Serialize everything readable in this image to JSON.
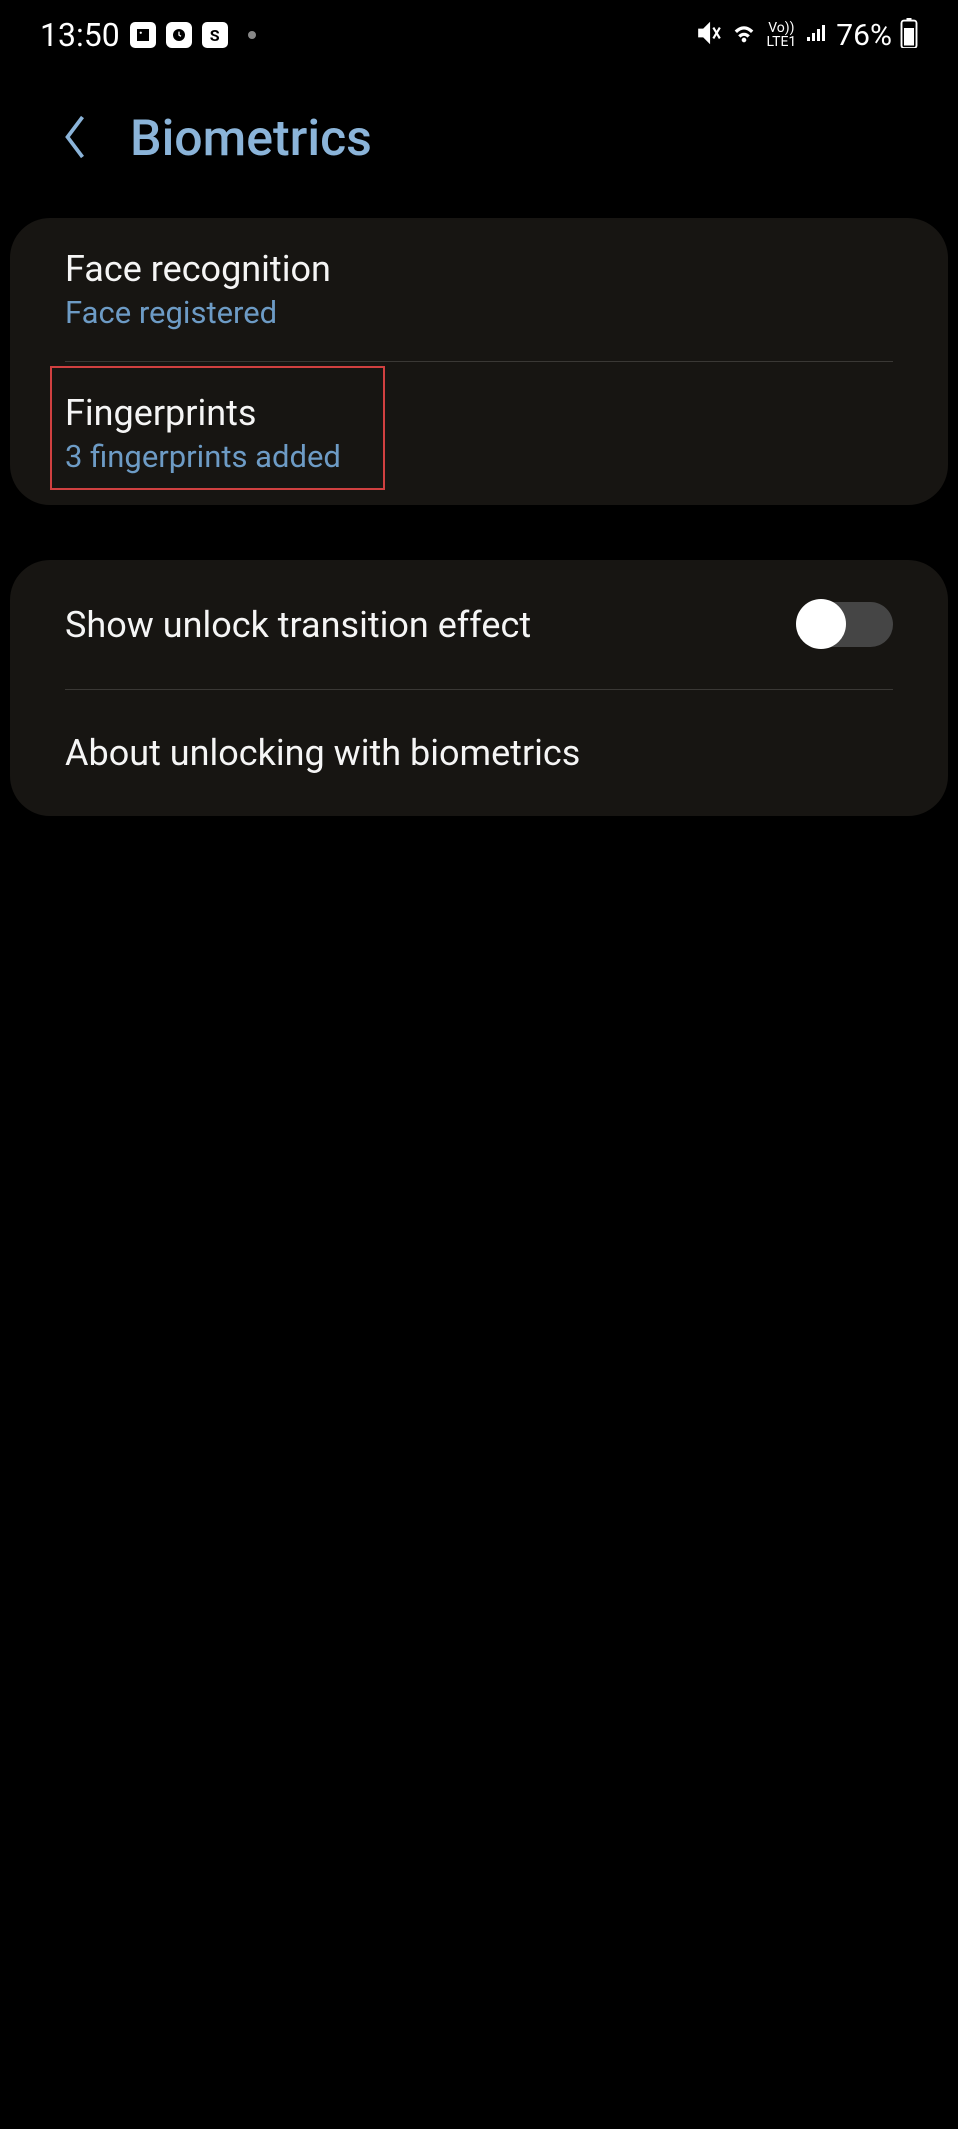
{
  "status_bar": {
    "time": "13:50",
    "battery": "76%",
    "lte_label": "LTE1",
    "vo_label": "Vo))"
  },
  "header": {
    "title": "Biometrics"
  },
  "card1": {
    "face_recognition": {
      "title": "Face recognition",
      "subtitle": "Face registered"
    },
    "fingerprints": {
      "title": "Fingerprints",
      "subtitle": "3 fingerprints added"
    }
  },
  "card2": {
    "unlock_effect": {
      "title": "Show unlock transition effect",
      "toggle_on": false
    },
    "about": {
      "title": "About unlocking with biometrics"
    }
  }
}
